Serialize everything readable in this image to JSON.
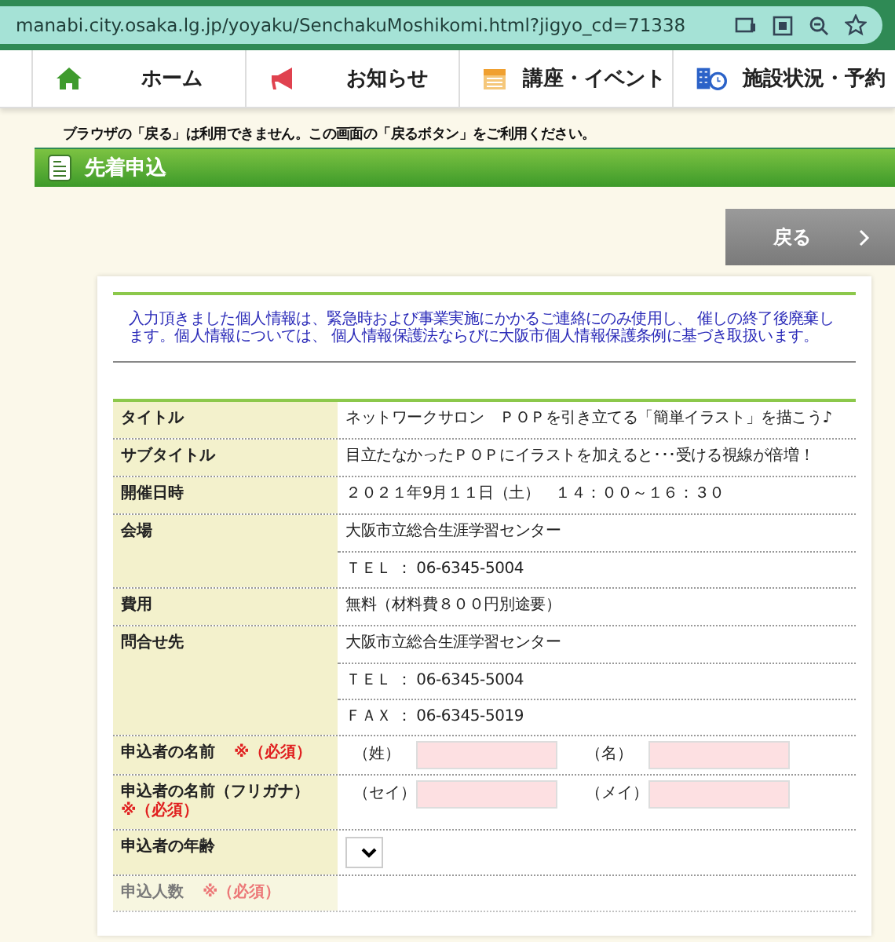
{
  "browser": {
    "url": "manabi.city.osaka.lg.jp/yoyaku/SenchakuMoshikomi.html?jigyo_cd=71338"
  },
  "nav": [
    {
      "label": "ホーム"
    },
    {
      "label": "お知らせ"
    },
    {
      "label": "講座・イベント"
    },
    {
      "label": "施設状況・予約"
    }
  ],
  "notice": "ブラウザの「戻る」は利用できません。この画面の「戻るボタン」をご利用ください。",
  "section_title": "先着申込",
  "back_button": {
    "label": "戻る"
  },
  "privacy_note": "入力頂きました個人情報は、緊急時および事業実施にかかるご連絡にのみ使用し、 催しの終了後廃棄します。個人情報については、 個人情報保護法ならびに大阪市個人情報保護条例に基づき取扱います。",
  "rows": [
    {
      "kind": "text",
      "label": "タイトル",
      "values": [
        "ネットワークサロン　ＰＯＰを引き立てる「簡単イラスト」を描こう♪"
      ]
    },
    {
      "kind": "text",
      "label": "サブタイトル",
      "values": [
        "目立たなかったＰＯＰにイラストを加えると･･･受ける視線が倍増！"
      ]
    },
    {
      "kind": "text",
      "label": "開催日時",
      "values": [
        "２０２１年9月１１日（土）　１４：００～１６：３０"
      ]
    },
    {
      "kind": "text",
      "label": "会場",
      "values": [
        "大阪市立総合生涯学習センター",
        "ＴＥＬ ： 06-6345-5004"
      ]
    },
    {
      "kind": "text",
      "label": "費用",
      "values": [
        "無料（材料費８００円別途要）"
      ]
    },
    {
      "kind": "text",
      "label": "問合せ先",
      "values": [
        "大阪市立総合生涯学習センター",
        "ＴＥＬ ： 06-6345-5004",
        "ＦＡＸ ： 06-6345-5019"
      ]
    },
    {
      "kind": "inputs",
      "label": "申込者の名前",
      "required": "※（必須）",
      "required_on_new_line": false,
      "fields": [
        {
          "label": "（姓）"
        },
        {
          "label": "（名）"
        }
      ]
    },
    {
      "kind": "inputs",
      "label": "申込者の名前（フリガナ）",
      "required": "※（必須）",
      "required_on_new_line": true,
      "fields": [
        {
          "label": "（セイ）"
        },
        {
          "label": "（メイ）"
        }
      ]
    },
    {
      "kind": "select",
      "label": "申込者の年齢"
    },
    {
      "kind": "text",
      "label": "申込人数",
      "required": "※（必須）",
      "faded": true,
      "values": []
    }
  ]
}
